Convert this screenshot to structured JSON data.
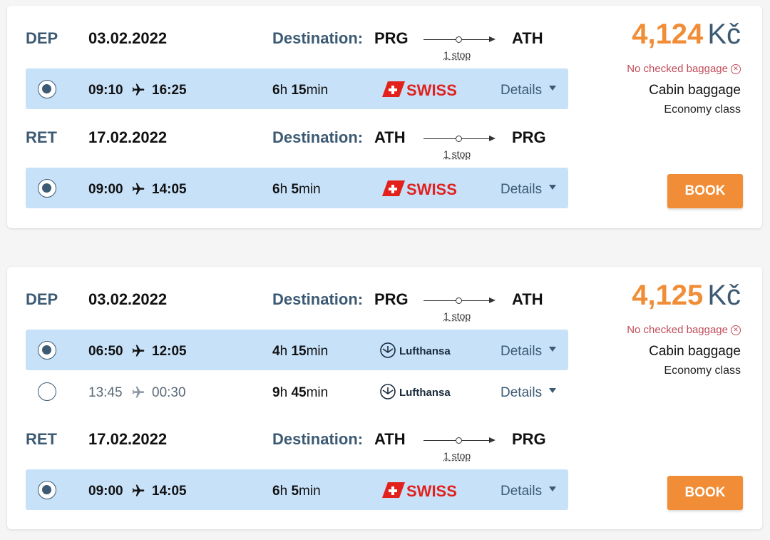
{
  "offers": [
    {
      "price": "4,124",
      "currency": "Kč",
      "no_checked_baggage": "No checked baggage",
      "cabin_baggage": "Cabin baggage",
      "class": "Economy class",
      "book_label": "BOOK",
      "outbound": {
        "label": "DEP",
        "date": "03.02.2022",
        "destination_label": "Destination:",
        "from": "PRG",
        "to": "ATH",
        "stops": "1 stop",
        "flights": [
          {
            "selected": true,
            "dep": "09:10",
            "arr": "16:25",
            "dur_h": "6",
            "dur_h_unit": "h",
            "dur_m": "15",
            "dur_m_unit": "min",
            "airline": "SWISS",
            "details": "Details"
          }
        ]
      },
      "inbound": {
        "label": "RET",
        "date": "17.02.2022",
        "destination_label": "Destination:",
        "from": "ATH",
        "to": "PRG",
        "stops": "1 stop",
        "flights": [
          {
            "selected": true,
            "dep": "09:00",
            "arr": "14:05",
            "dur_h": "6",
            "dur_h_unit": "h",
            "dur_m": "5",
            "dur_m_unit": "min",
            "airline": "SWISS",
            "details": "Details"
          }
        ]
      }
    },
    {
      "price": "4,125",
      "currency": "Kč",
      "no_checked_baggage": "No checked baggage",
      "cabin_baggage": "Cabin baggage",
      "class": "Economy class",
      "book_label": "BOOK",
      "outbound": {
        "label": "DEP",
        "date": "03.02.2022",
        "destination_label": "Destination:",
        "from": "PRG",
        "to": "ATH",
        "stops": "1 stop",
        "flights": [
          {
            "selected": true,
            "dep": "06:50",
            "arr": "12:05",
            "dur_h": "4",
            "dur_h_unit": "h",
            "dur_m": "15",
            "dur_m_unit": "min",
            "airline": "Lufthansa",
            "details": "Details"
          },
          {
            "selected": false,
            "dep": "13:45",
            "arr": "00:30",
            "dur_h": "9",
            "dur_h_unit": "h",
            "dur_m": "45",
            "dur_m_unit": "min",
            "airline": "Lufthansa",
            "details": "Details"
          }
        ]
      },
      "inbound": {
        "label": "RET",
        "date": "17.02.2022",
        "destination_label": "Destination:",
        "from": "ATH",
        "to": "PRG",
        "stops": "1 stop",
        "flights": [
          {
            "selected": true,
            "dep": "09:00",
            "arr": "14:05",
            "dur_h": "6",
            "dur_h_unit": "h",
            "dur_m": "5",
            "dur_m_unit": "min",
            "airline": "SWISS",
            "details": "Details"
          }
        ]
      }
    }
  ],
  "colors": {
    "accent_orange": "#f08d36",
    "heading_blue": "#3c5a73",
    "selected_row": "#c7e1f9",
    "swiss_red": "#e2211c",
    "warning_red": "#c24d5a"
  },
  "icons": {
    "plane": "plane-icon",
    "radio": "radio-icon",
    "caret": "chevron-down-icon",
    "no_bag": "close-circle-icon"
  }
}
